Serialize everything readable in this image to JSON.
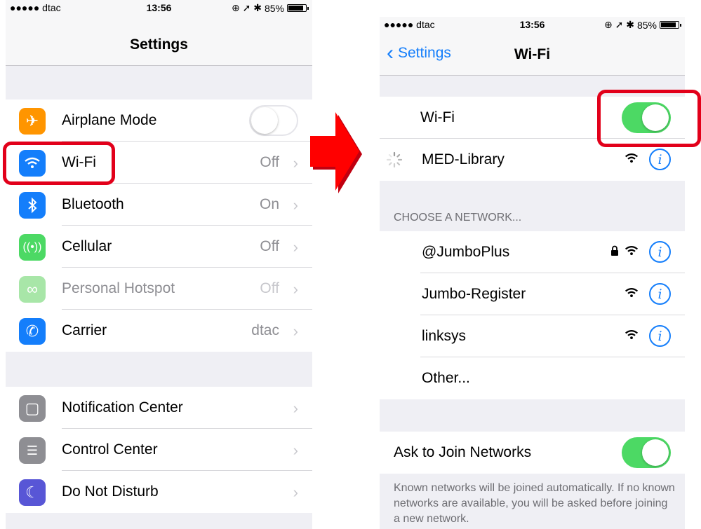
{
  "left": {
    "status": {
      "carrier": "●●●●● dtac",
      "time": "13:56",
      "battery": "85%"
    },
    "nav_title": "Settings",
    "rows": [
      {
        "label": "Airplane Mode",
        "icon": "airplane-icon",
        "color": "#ff9500"
      },
      {
        "label": "Wi-Fi",
        "value": "Off",
        "icon": "wifi-icon",
        "color": "#147efb"
      },
      {
        "label": "Bluetooth",
        "value": "On",
        "icon": "bluetooth-icon",
        "color": "#147efb"
      },
      {
        "label": "Cellular",
        "value": "Off",
        "icon": "cellular-icon",
        "color": "#4cd964"
      },
      {
        "label": "Personal Hotspot",
        "value": "Off",
        "icon": "hotspot-icon",
        "color": "#a8e6a8"
      },
      {
        "label": "Carrier",
        "value": "dtac",
        "icon": "phone-icon",
        "color": "#147efb"
      },
      {
        "label": "Notification Center",
        "icon": "notification-icon",
        "color": "#8e8e93"
      },
      {
        "label": "Control Center",
        "icon": "control-center-icon",
        "color": "#8e8e93"
      },
      {
        "label": "Do Not Disturb",
        "icon": "moon-icon",
        "color": "#5856d6"
      }
    ],
    "airplane_mode_on": false
  },
  "right": {
    "status": {
      "carrier": "●●●●● dtac",
      "time": "13:56",
      "battery": "85%"
    },
    "back_label": "Settings",
    "nav_title": "Wi-Fi",
    "wifi_label": "Wi-Fi",
    "wifi_on": true,
    "current_network": "MED-Library",
    "section_header": "CHOOSE A NETWORK...",
    "networks": [
      {
        "name": "@JumboPlus",
        "locked": true
      },
      {
        "name": "Jumbo-Register",
        "locked": false
      },
      {
        "name": "linksys",
        "locked": false
      }
    ],
    "other_label": "Other...",
    "ask_label": "Ask to Join Networks",
    "ask_on": true,
    "footer": "Known networks will be joined automatically. If no known networks are available, you will be asked before joining a new network."
  },
  "colors": {
    "highlight": "#e2001a",
    "ios_blue": "#147efb",
    "toggle_green": "#4cd964"
  }
}
